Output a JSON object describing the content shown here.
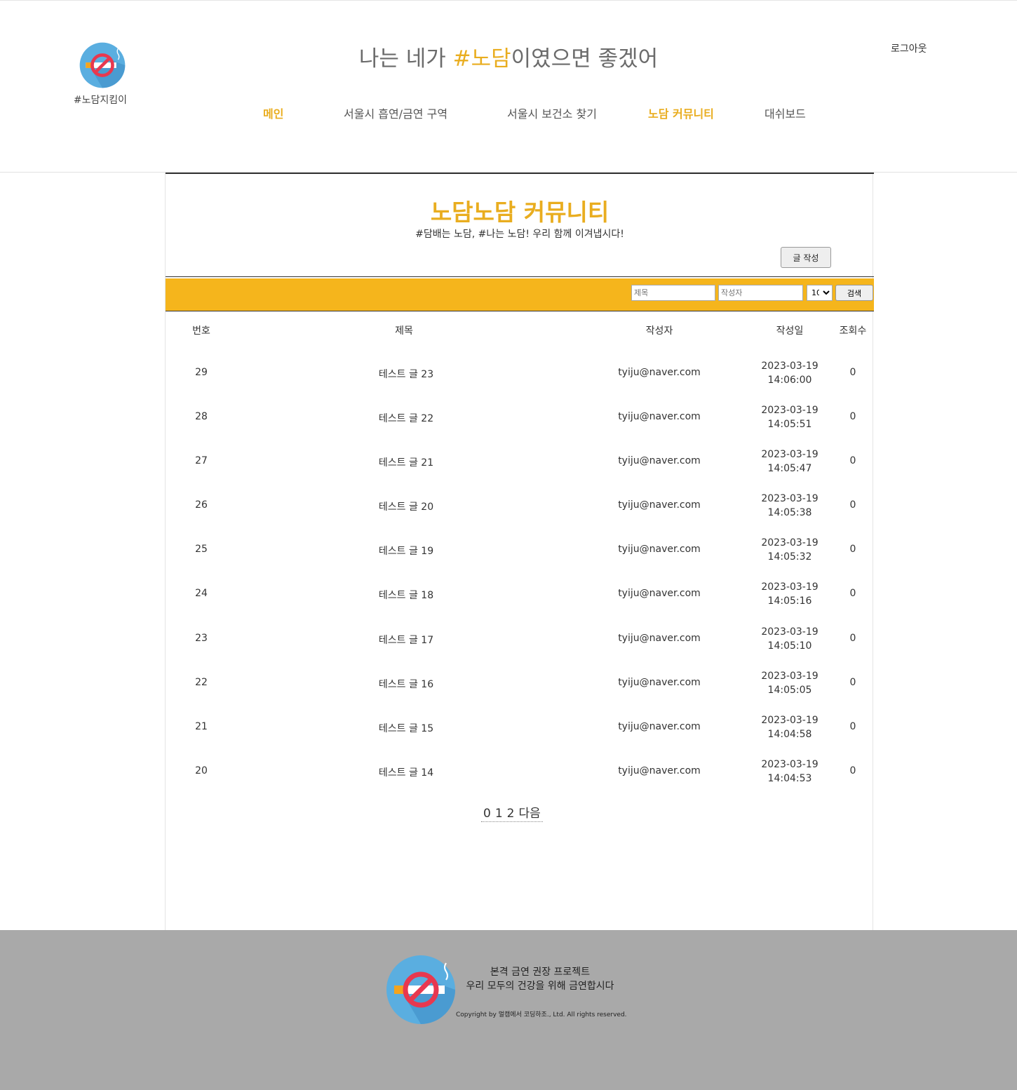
{
  "brand": {
    "logo_text": "#노담지킴이"
  },
  "header": {
    "slogan_pre": "나는 네가 ",
    "slogan_accent": "#노담",
    "slogan_post": "이였으면 좋겠어",
    "logout": "로그아웃"
  },
  "nav": {
    "items": [
      {
        "label": "메인"
      },
      {
        "label": "서울시 흡연/금연 구역"
      },
      {
        "label": "서울시 보건소 찾기"
      },
      {
        "label": "노담 커뮤니티"
      },
      {
        "label": "대쉬보드"
      }
    ]
  },
  "board": {
    "title": "노담노담 커뮤니티",
    "subtitle": "#담배는 노담, #나는 노담! 우리 함께 이겨냅시다!",
    "write_button": "글 작성",
    "search": {
      "title_placeholder": "제목",
      "author_placeholder": "작성자",
      "count_value": "10",
      "button": "검색"
    },
    "columns": {
      "num": "번호",
      "title": "제목",
      "author": "작성자",
      "date": "작성일",
      "views": "조회수"
    },
    "rows": [
      {
        "num": "29",
        "title": "테스트 글 23",
        "author": "tyiju@naver.com",
        "date": "2023-03-19",
        "time": "14:06:00",
        "views": "0"
      },
      {
        "num": "28",
        "title": "테스트 글 22",
        "author": "tyiju@naver.com",
        "date": "2023-03-19",
        "time": "14:05:51",
        "views": "0"
      },
      {
        "num": "27",
        "title": "테스트 글 21",
        "author": "tyiju@naver.com",
        "date": "2023-03-19",
        "time": "14:05:47",
        "views": "0"
      },
      {
        "num": "26",
        "title": "테스트 글 20",
        "author": "tyiju@naver.com",
        "date": "2023-03-19",
        "time": "14:05:38",
        "views": "0"
      },
      {
        "num": "25",
        "title": "테스트 글 19",
        "author": "tyiju@naver.com",
        "date": "2023-03-19",
        "time": "14:05:32",
        "views": "0"
      },
      {
        "num": "24",
        "title": "테스트 글 18",
        "author": "tyiju@naver.com",
        "date": "2023-03-19",
        "time": "14:05:16",
        "views": "0"
      },
      {
        "num": "23",
        "title": "테스트 글 17",
        "author": "tyiju@naver.com",
        "date": "2023-03-19",
        "time": "14:05:10",
        "views": "0"
      },
      {
        "num": "22",
        "title": "테스트 글 16",
        "author": "tyiju@naver.com",
        "date": "2023-03-19",
        "time": "14:05:05",
        "views": "0"
      },
      {
        "num": "21",
        "title": "테스트 글 15",
        "author": "tyiju@naver.com",
        "date": "2023-03-19",
        "time": "14:04:58",
        "views": "0"
      },
      {
        "num": "20",
        "title": "테스트 글 14",
        "author": "tyiju@naver.com",
        "date": "2023-03-19",
        "time": "14:04:53",
        "views": "0"
      }
    ],
    "pager": {
      "pages": [
        "0",
        "1",
        "2"
      ],
      "next": "다음"
    }
  },
  "footer": {
    "line1": "본격 금연 권장 프로젝트",
    "line2": "우리 모두의 건강을 위해 금연합시다",
    "copyright": "Copyright by 멀캠에서 코딩하조., Ltd. All rights reserved."
  },
  "colors": {
    "accent": "#e9ad1f",
    "search_bar": "#f5b51c",
    "footer_bg": "#a9a9a9",
    "logo_circle": "#5aaee0"
  },
  "icons": {
    "logo": "no-smoking-icon"
  }
}
